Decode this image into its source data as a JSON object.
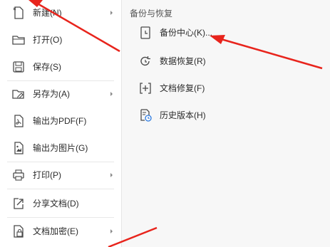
{
  "left_menu": {
    "items": [
      {
        "label": "新建(N)",
        "icon": "new-document-icon",
        "has_submenu": true
      },
      {
        "label": "打开(O)",
        "icon": "folder-open-icon",
        "has_submenu": false
      },
      {
        "label": "保存(S)",
        "icon": "save-icon",
        "has_submenu": false
      },
      {
        "label": "另存为(A)",
        "icon": "save-as-icon",
        "has_submenu": true
      },
      {
        "label": "输出为PDF(F)",
        "icon": "export-pdf-icon",
        "has_submenu": false
      },
      {
        "label": "输出为图片(G)",
        "icon": "export-image-icon",
        "has_submenu": false
      },
      {
        "label": "打印(P)",
        "icon": "print-icon",
        "has_submenu": true
      },
      {
        "label": "分享文档(D)",
        "icon": "share-icon",
        "has_submenu": false
      },
      {
        "label": "文档加密(E)",
        "icon": "encrypt-icon",
        "has_submenu": true
      }
    ]
  },
  "submenu": {
    "title": "备份与恢复",
    "items": [
      {
        "label": "备份中心(K)...",
        "icon": "backup-center-icon"
      },
      {
        "label": "数据恢复(R)",
        "icon": "data-recovery-icon"
      },
      {
        "label": "文档修复(F)",
        "icon": "document-repair-icon"
      },
      {
        "label": "历史版本(H)",
        "icon": "history-version-icon"
      }
    ]
  },
  "colors": {
    "accent": "#e8241c",
    "icon": "#4a4a4a",
    "menu_bg": "#ffffff",
    "submenu_bg": "#f7f7f7"
  }
}
